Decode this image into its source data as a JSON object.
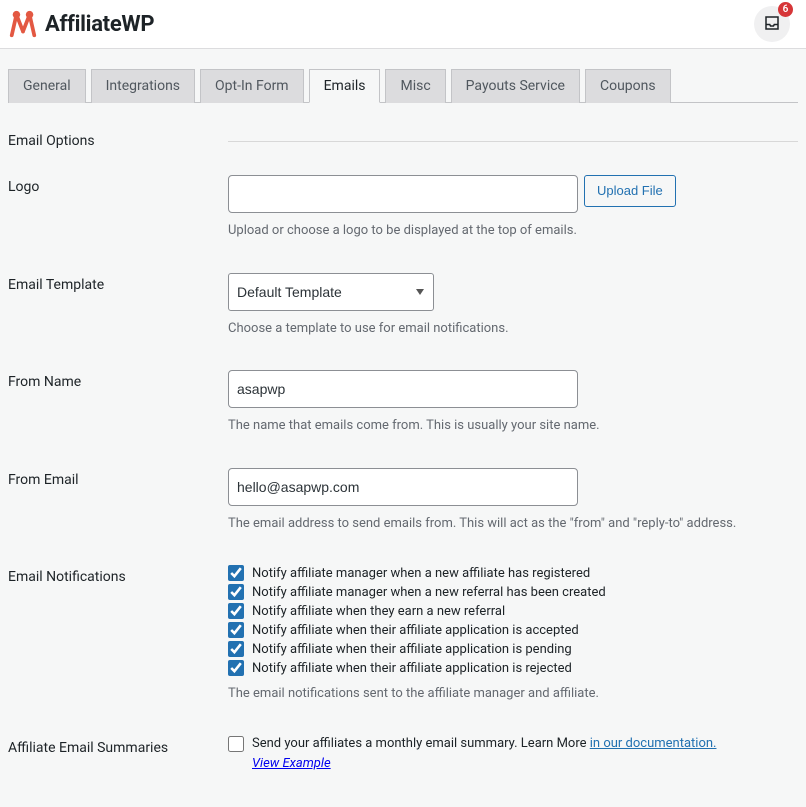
{
  "header": {
    "brand": "AffiliateWP",
    "notif_count": "6"
  },
  "tabs": [
    {
      "label": "General",
      "active": false
    },
    {
      "label": "Integrations",
      "active": false
    },
    {
      "label": "Opt-In Form",
      "active": false
    },
    {
      "label": "Emails",
      "active": true
    },
    {
      "label": "Misc",
      "active": false
    },
    {
      "label": "Payouts Service",
      "active": false
    },
    {
      "label": "Coupons",
      "active": false
    }
  ],
  "section_title": "Email Options",
  "fields": {
    "logo": {
      "label": "Logo",
      "value": "",
      "upload_button": "Upload File",
      "help": "Upload or choose a logo to be displayed at the top of emails."
    },
    "template": {
      "label": "Email Template",
      "selected": "Default Template",
      "help": "Choose a template to use for email notifications."
    },
    "from_name": {
      "label": "From Name",
      "value": "asapwp",
      "help": "The name that emails come from. This is usually your site name."
    },
    "from_email": {
      "label": "From Email",
      "value": "hello@asapwp.com",
      "help": "The email address to send emails from. This will act as the \"from\" and \"reply-to\" address."
    },
    "notifications": {
      "label": "Email Notifications",
      "items": [
        {
          "label": "Notify affiliate manager when a new affiliate has registered",
          "checked": true
        },
        {
          "label": "Notify affiliate manager when a new referral has been created",
          "checked": true
        },
        {
          "label": "Notify affiliate when they earn a new referral",
          "checked": true
        },
        {
          "label": "Notify affiliate when their affiliate application is accepted",
          "checked": true
        },
        {
          "label": "Notify affiliate when their affiliate application is pending",
          "checked": true
        },
        {
          "label": "Notify affiliate when their affiliate application is rejected",
          "checked": true
        }
      ],
      "help": "The email notifications sent to the affiliate manager and affiliate."
    },
    "summaries": {
      "label": "Affiliate Email Summaries",
      "checked": false,
      "text_before": "Send your affiliates a monthly email summary. Learn More ",
      "link_text": "in our documentation.",
      "view_example": "View Example"
    }
  }
}
